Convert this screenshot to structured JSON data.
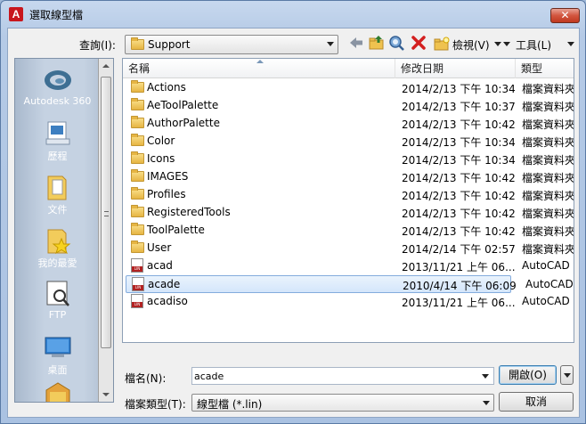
{
  "window": {
    "title": "選取線型檔",
    "close_label": "✕"
  },
  "lookin": {
    "label": "查詢(I):",
    "value": "Support"
  },
  "toolbar": {
    "views_label": "檢視(V)",
    "tools_label": "工具(L)"
  },
  "places": [
    {
      "label": "Autodesk 360",
      "icon": "autodesk-360-icon"
    },
    {
      "label": "歷程",
      "icon": "history-icon"
    },
    {
      "label": "文件",
      "icon": "documents-icon"
    },
    {
      "label": "我的最愛",
      "icon": "favorites-icon"
    },
    {
      "label": "FTP",
      "icon": "ftp-icon"
    },
    {
      "label": "桌面",
      "icon": "desktop-icon"
    }
  ],
  "columns": {
    "name": "名稱",
    "date": "修改日期",
    "type": "類型"
  },
  "files": [
    {
      "name": "Actions",
      "date": "2014/2/13 下午 10:34",
      "type": "檔案資料夾",
      "kind": "folder"
    },
    {
      "name": "AeToolPalette",
      "date": "2014/2/13 下午 10:37",
      "type": "檔案資料夾",
      "kind": "folder"
    },
    {
      "name": "AuthorPalette",
      "date": "2014/2/13 下午 10:42",
      "type": "檔案資料夾",
      "kind": "folder"
    },
    {
      "name": "Color",
      "date": "2014/2/13 下午 10:34",
      "type": "檔案資料夾",
      "kind": "folder"
    },
    {
      "name": "Icons",
      "date": "2014/2/13 下午 10:34",
      "type": "檔案資料夾",
      "kind": "folder"
    },
    {
      "name": "IMAGES",
      "date": "2014/2/13 下午 10:42",
      "type": "檔案資料夾",
      "kind": "folder"
    },
    {
      "name": "Profiles",
      "date": "2014/2/13 下午 10:42",
      "type": "檔案資料夾",
      "kind": "folder"
    },
    {
      "name": "RegisteredTools",
      "date": "2014/2/13 下午 10:42",
      "type": "檔案資料夾",
      "kind": "folder"
    },
    {
      "name": "ToolPalette",
      "date": "2014/2/13 下午 10:42",
      "type": "檔案資料夾",
      "kind": "folder"
    },
    {
      "name": "User",
      "date": "2014/2/14 下午 02:57",
      "type": "檔案資料夾",
      "kind": "folder"
    },
    {
      "name": "acad",
      "date": "2013/11/21 上午 06...",
      "type": "AutoCAD",
      "kind": "lin"
    },
    {
      "name": "acade",
      "date": "2010/4/14 下午 06:09",
      "type": "AutoCAD",
      "kind": "lin",
      "selected": true
    },
    {
      "name": "acadiso",
      "date": "2013/11/21 上午 06...",
      "type": "AutoCAD",
      "kind": "lin"
    }
  ],
  "filename": {
    "label": "檔名(N):",
    "value": "acade"
  },
  "filetype": {
    "label": "檔案類型(T):",
    "value": "線型檔 (*.lin)"
  },
  "buttons": {
    "open": "開啟(O)",
    "cancel": "取消"
  }
}
